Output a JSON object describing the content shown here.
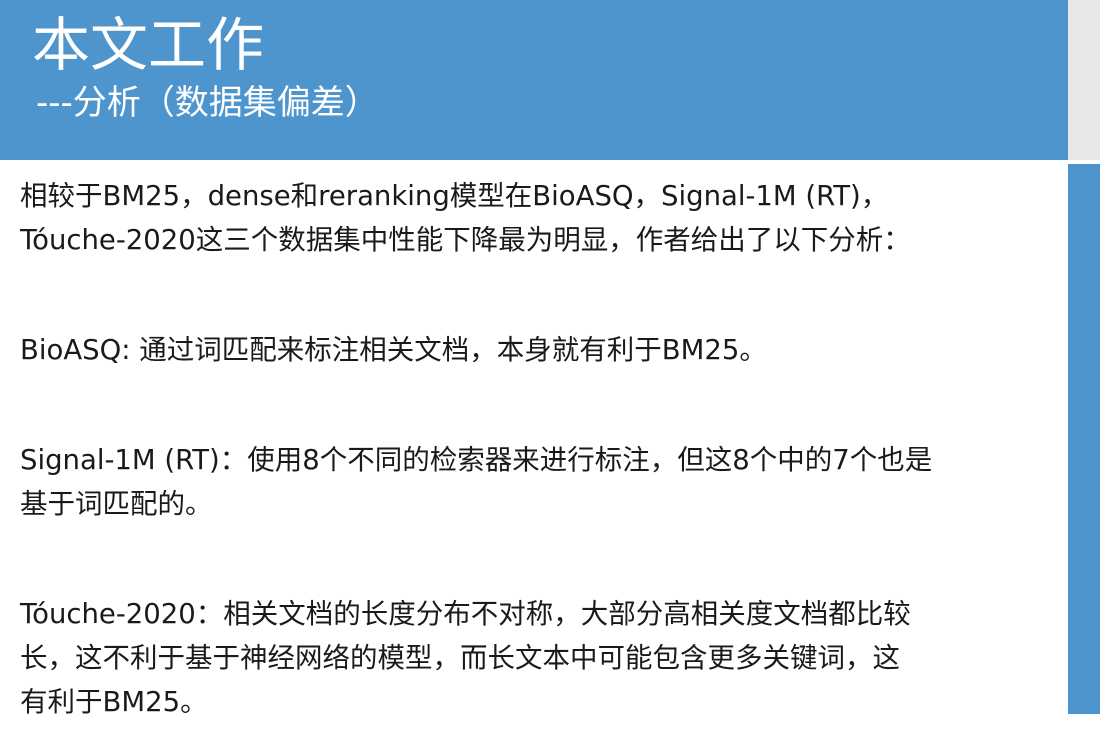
{
  "slide": {
    "title": "本文工作",
    "subtitle": "---分析（数据集偏差）",
    "intro": [
      "相较于BM25，dense和reranking模型在BioASQ，Signal-1M (RT)，",
      "Tóuche-2020这三个数据集中性能下降最为明显，作者给出了以下分析："
    ],
    "points": [
      {
        "lines": [
          "BioASQ: 通过词匹配来标注相关文档，本身就有利于BM25。"
        ]
      },
      {
        "lines": [
          "Signal-1M (RT)：使用8个不同的检索器来进行标注，但这8个中的7个也是",
          "基于词匹配的。"
        ]
      },
      {
        "lines": [
          "Tóuche-2020：相关文档的长度分布不对称，大部分高相关度文档都比较",
          "长，这不利于基于神经网络的模型，而长文本中可能包含更多关键词，这",
          "有利于BM25。"
        ]
      }
    ]
  },
  "colors": {
    "accent": "#4f95cd",
    "strip_gray": "#e7e7e7",
    "text": "#1a1a1a"
  }
}
